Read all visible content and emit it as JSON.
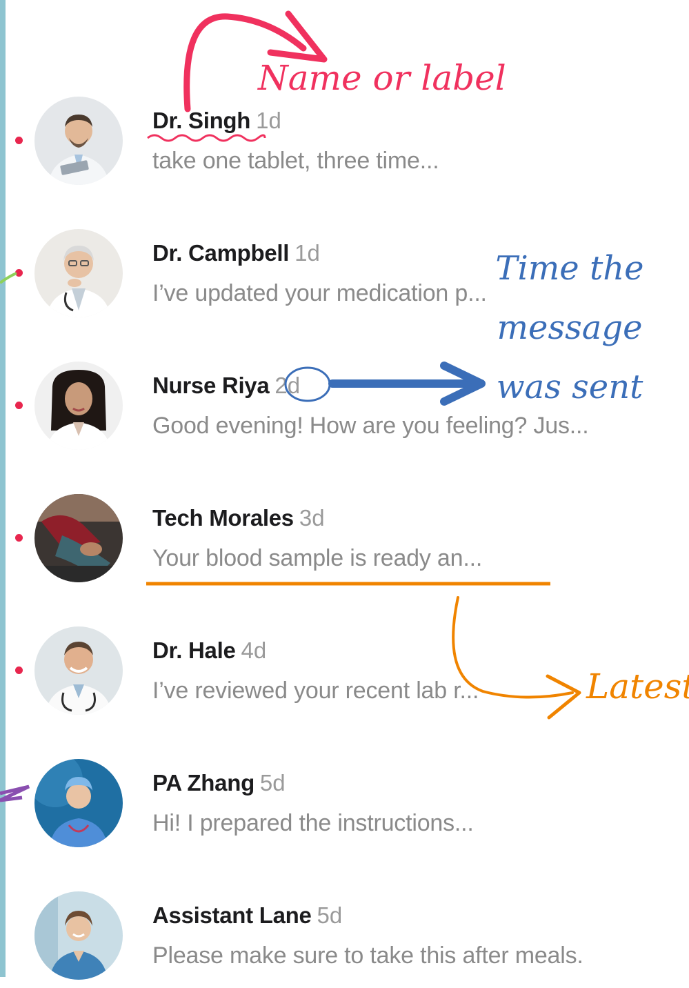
{
  "conversations": [
    {
      "name": "Dr. Singh",
      "time": "1d",
      "preview": "take one tablet, three time...",
      "unread": true,
      "avatar": "doctor-tablet-avatar"
    },
    {
      "name": "Dr. Campbell",
      "time": "1d",
      "preview": "I’ve updated your medication p...",
      "unread": true,
      "avatar": "elderly-doctor-avatar"
    },
    {
      "name": "Nurse Riya",
      "time": "2d",
      "preview": "Good evening! How are you feeling? Jus...",
      "unread": true,
      "avatar": "nurse-avatar"
    },
    {
      "name": "Tech Morales",
      "time": "3d",
      "preview": "Your blood sample is ready an...",
      "unread": true,
      "avatar": "lab-tech-avatar"
    },
    {
      "name": "Dr. Hale",
      "time": "4d",
      "preview": "I’ve reviewed your recent lab r...",
      "unread": true,
      "avatar": "smiling-doctor-avatar"
    },
    {
      "name": "PA Zhang",
      "time": "5d",
      "preview": "Hi! I prepared the instructions...",
      "unread": false,
      "avatar": "scrubs-avatar"
    },
    {
      "name": "Assistant Lane",
      "time": "5d",
      "preview": "Please make sure to take this after meals.",
      "unread": false,
      "avatar": "assistant-avatar"
    }
  ],
  "annotations": {
    "name_label": "Name or label",
    "time_label": "Time the message was sent",
    "latest_label": "Latest"
  },
  "colors": {
    "unread_dot": "#e8264e",
    "annotation_pink": "#f0315e",
    "annotation_blue": "#3b6eb8",
    "annotation_orange": "#f08400",
    "left_bar": "#8ec4d0"
  }
}
